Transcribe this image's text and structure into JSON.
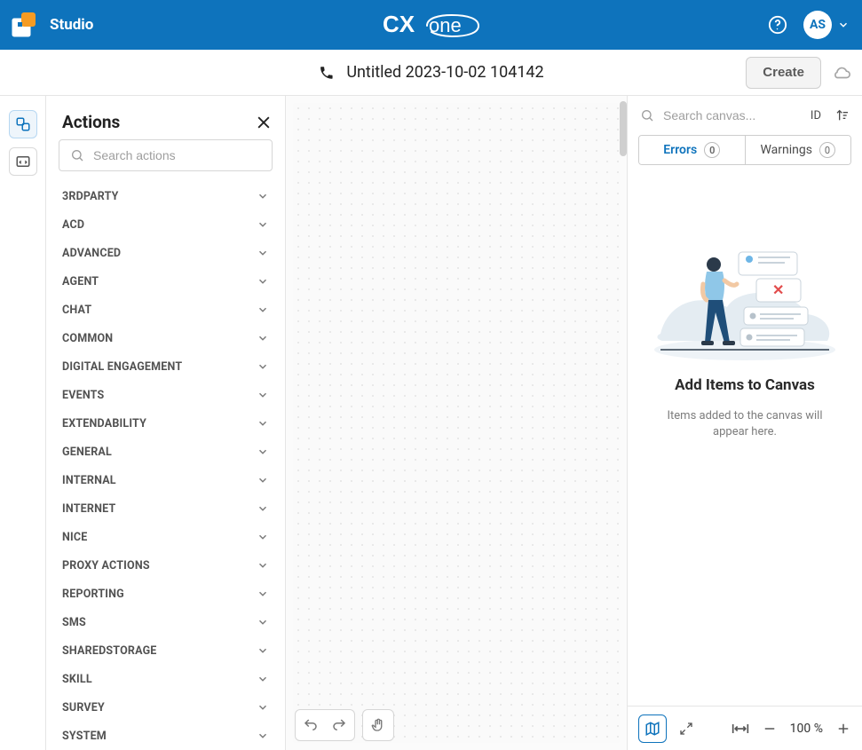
{
  "app": {
    "name": "Studio",
    "user_initials": "AS"
  },
  "document": {
    "title": "Untitled 2023-10-02 104142",
    "create_label": "Create"
  },
  "actions_panel": {
    "title": "Actions",
    "search_placeholder": "Search actions",
    "categories": [
      {
        "label": "3RDPARTY"
      },
      {
        "label": "ACD"
      },
      {
        "label": "ADVANCED"
      },
      {
        "label": "AGENT"
      },
      {
        "label": "CHAT"
      },
      {
        "label": "COMMON"
      },
      {
        "label": "DIGITAL ENGAGEMENT"
      },
      {
        "label": "EVENTS"
      },
      {
        "label": "EXTENDABILITY"
      },
      {
        "label": "GENERAL"
      },
      {
        "label": "INTERNAL"
      },
      {
        "label": "INTERNET"
      },
      {
        "label": "NICE"
      },
      {
        "label": "PROXY ACTIONS"
      },
      {
        "label": "REPORTING"
      },
      {
        "label": "SMS"
      },
      {
        "label": "SHAREDSTORAGE"
      },
      {
        "label": "SKILL"
      },
      {
        "label": "SURVEY"
      },
      {
        "label": "SYSTEM"
      }
    ]
  },
  "right_panel": {
    "search_placeholder": "Search canvas...",
    "id_label": "ID",
    "tabs": {
      "errors_label": "Errors",
      "errors_count": "0",
      "warnings_label": "Warnings",
      "warnings_count": "0"
    },
    "empty_title": "Add Items to Canvas",
    "empty_body": "Items added to the canvas will appear here."
  },
  "zoom": {
    "percent": "100 %"
  }
}
